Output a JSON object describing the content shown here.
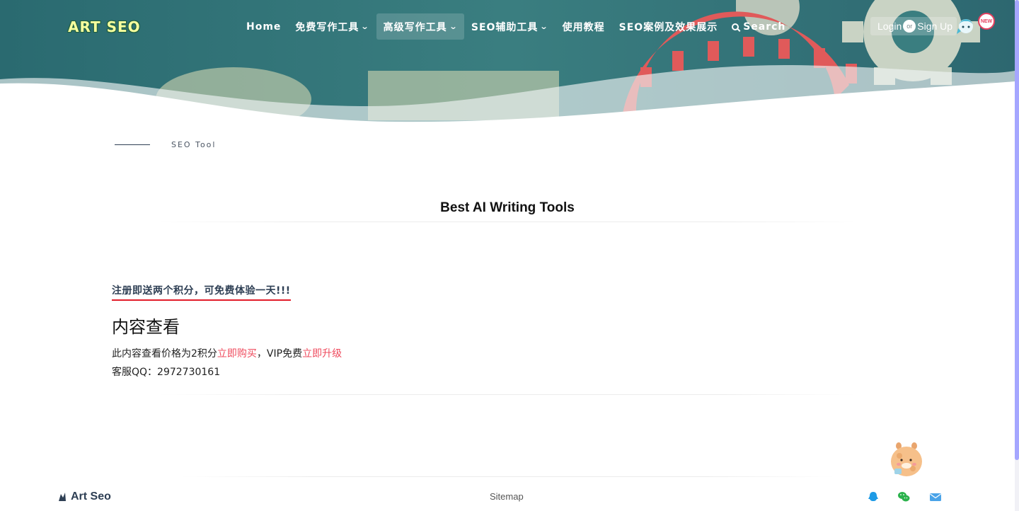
{
  "header": {
    "logo": "ART SEO",
    "nav": [
      {
        "label": "Home",
        "dropdown": false
      },
      {
        "label": "免费写作工具",
        "dropdown": true
      },
      {
        "label": "高级写作工具",
        "dropdown": true,
        "active": true
      },
      {
        "label": "SEO辅助工具",
        "dropdown": true
      },
      {
        "label": "使用教程",
        "dropdown": false
      },
      {
        "label": "SEO案例及效果展示",
        "dropdown": false
      },
      {
        "label": "Search",
        "icon": "search-icon"
      }
    ],
    "login_label": "Login",
    "or_label": "or",
    "signup_label": "Sign Up",
    "new_badge": "NEW"
  },
  "breadcrumb": {
    "label": "SEO Tool"
  },
  "main": {
    "title": "Best AI Writing Tools",
    "promo": "注册即送两个积分，可免费体验一天!!!",
    "section_heading": "内容查看",
    "price_prefix": "此内容查看价格为2积分",
    "buy_link": "立即购买",
    "vip_text": "，VIP免费",
    "upgrade_link": "立即升级",
    "qq_text": "客服QQ：2972730161"
  },
  "footer": {
    "brand": "Art Seo",
    "sitemap": "Sitemap",
    "social_icons": [
      "qq-icon",
      "wechat-icon",
      "email-icon"
    ]
  },
  "colors": {
    "hero_teal": "#2f6f73",
    "accent_red": "#ef4b5e",
    "underline_red": "#e11d2a",
    "brand_navy": "#2e3f54",
    "scrollbar": "#a5a6ff"
  }
}
